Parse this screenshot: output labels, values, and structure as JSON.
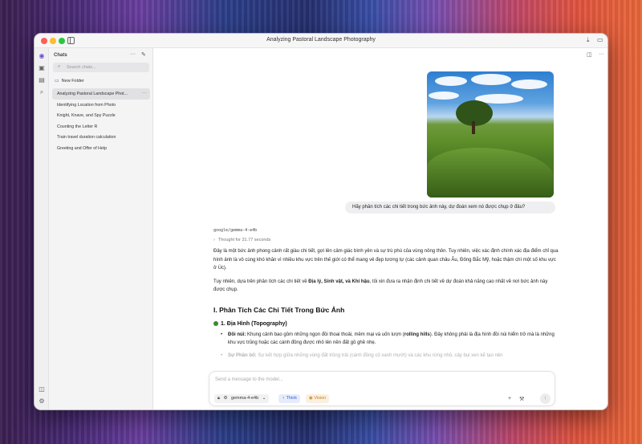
{
  "window": {
    "title": "Analyzing Pastoral Landscape Photography"
  },
  "sidebar": {
    "header": "Chats",
    "more_glyph": "···",
    "search_placeholder": "Search chats...",
    "new_folder": "New Folder",
    "chats": [
      {
        "label": "Analyzing Pastoral Landscape Phot...",
        "active": true
      },
      {
        "label": "Identifying Location from Photo",
        "active": false
      },
      {
        "label": "Knight, Knave, and Spy Puzzle",
        "active": false
      },
      {
        "label": "Counting the Letter R",
        "active": false
      },
      {
        "label": "Train travel duration calculation",
        "active": false
      },
      {
        "label": "Greeting and Offer of Help",
        "active": false
      }
    ]
  },
  "conversation": {
    "user_message": "Hãy phân tích các chi tiết trong bức ảnh này, dự đoán xem nó được chụp ở đâu?",
    "model_name": "google/gemma-4-e4b",
    "thought": "Thought for 31.77 seconds",
    "para1": "Đây là một bức ảnh phong cảnh rất giàu chi tiết, gợi lên cảm giác bình yên và sự trù phú của vùng nông thôn. Tuy nhiên, việc xác định chính xác địa điểm chỉ qua hình ảnh là vô cùng khó khăn vì nhiều khu vực trên thế giới có thể mang vẻ đẹp tương tự (các cảnh quan châu Âu, Đông Bắc Mỹ, hoặc thậm chí một số khu vực ở Úc).",
    "para2_a": "Tuy nhiên, dựa trên phân tích các chi tiết về ",
    "para2_b": "Địa lý, Sinh vật, và Khí hậu",
    "para2_c": ", tôi xin đưa ra nhận định chi tiết về dự đoán khả năng cao nhất về nơi bức ảnh này được chụp.",
    "heading1": "I. Phân Tích Các Chi Tiết Trong Bức Ảnh",
    "heading2": "1. Địa Hình (Topography)",
    "bullet1_label": "Đồi núi:",
    "bullet1_a": " Khung cảnh bao gồm những ngọn đồi thoai thoải, mềm mại và uốn lượn (",
    "bullet1_b": "rolling hills",
    "bullet1_c": "). Đây không phải là địa hình đồi núi hiểm trở mà là những khu vực trũng hoặc các cánh đồng được nhô lên nền đất gồ ghề nhẹ.",
    "bullet2_label": "Sự Phân bố:",
    "bullet2_text": " Sự kết hợp giữa những vùng đất trồng trải (cánh đồng cỏ xanh mướt) và các khu rừng nhỏ, cây bụi xen kẽ tạo nên"
  },
  "composer": {
    "placeholder": "Send a message to the model...",
    "model": "gemma-4-e4b",
    "think": "Think",
    "vision": "Vision"
  }
}
